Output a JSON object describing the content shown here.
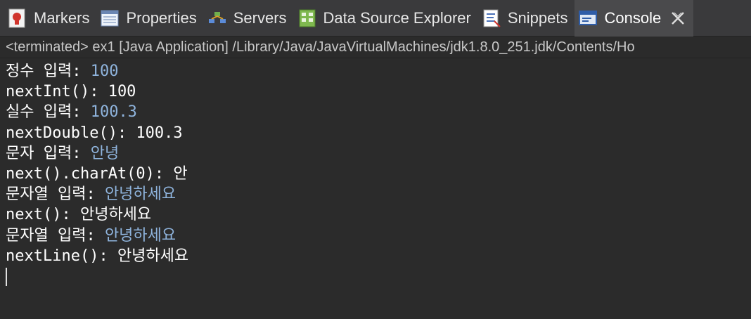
{
  "tabs": [
    {
      "label": "Markers",
      "icon": "markers-icon"
    },
    {
      "label": "Properties",
      "icon": "properties-icon"
    },
    {
      "label": "Servers",
      "icon": "servers-icon"
    },
    {
      "label": "Data Source Explorer",
      "icon": "data-source-explorer-icon"
    },
    {
      "label": "Snippets",
      "icon": "snippets-icon"
    },
    {
      "label": "Console",
      "icon": "console-icon",
      "active": true
    }
  ],
  "status": "<terminated> ex1 [Java Application] /Library/Java/JavaVirtualMachines/jdk1.8.0_251.jdk/Contents/Ho",
  "console": {
    "lines": [
      {
        "prompt": "정수 입력: ",
        "input": "100"
      },
      {
        "prompt": "nextInt(): 100",
        "input": ""
      },
      {
        "prompt": "실수 입력: ",
        "input": "100.3"
      },
      {
        "prompt": "nextDouble(): 100.3",
        "input": ""
      },
      {
        "prompt": "문자 입력: ",
        "input": "안녕"
      },
      {
        "prompt": "next().charAt(0): 안",
        "input": ""
      },
      {
        "prompt": "문자열 입력: ",
        "input": "안녕하세요"
      },
      {
        "prompt": "next(): 안녕하세요",
        "input": ""
      },
      {
        "prompt": "문자열 입력: ",
        "input": "안녕하세요"
      },
      {
        "prompt": "nextLine(): 안녕하세요",
        "input": ""
      }
    ]
  },
  "colors": {
    "background": "#2b2b2b",
    "tabbar": "#3a3a3c",
    "input_text": "#8fb4dd",
    "output_text": "#ffffff"
  }
}
